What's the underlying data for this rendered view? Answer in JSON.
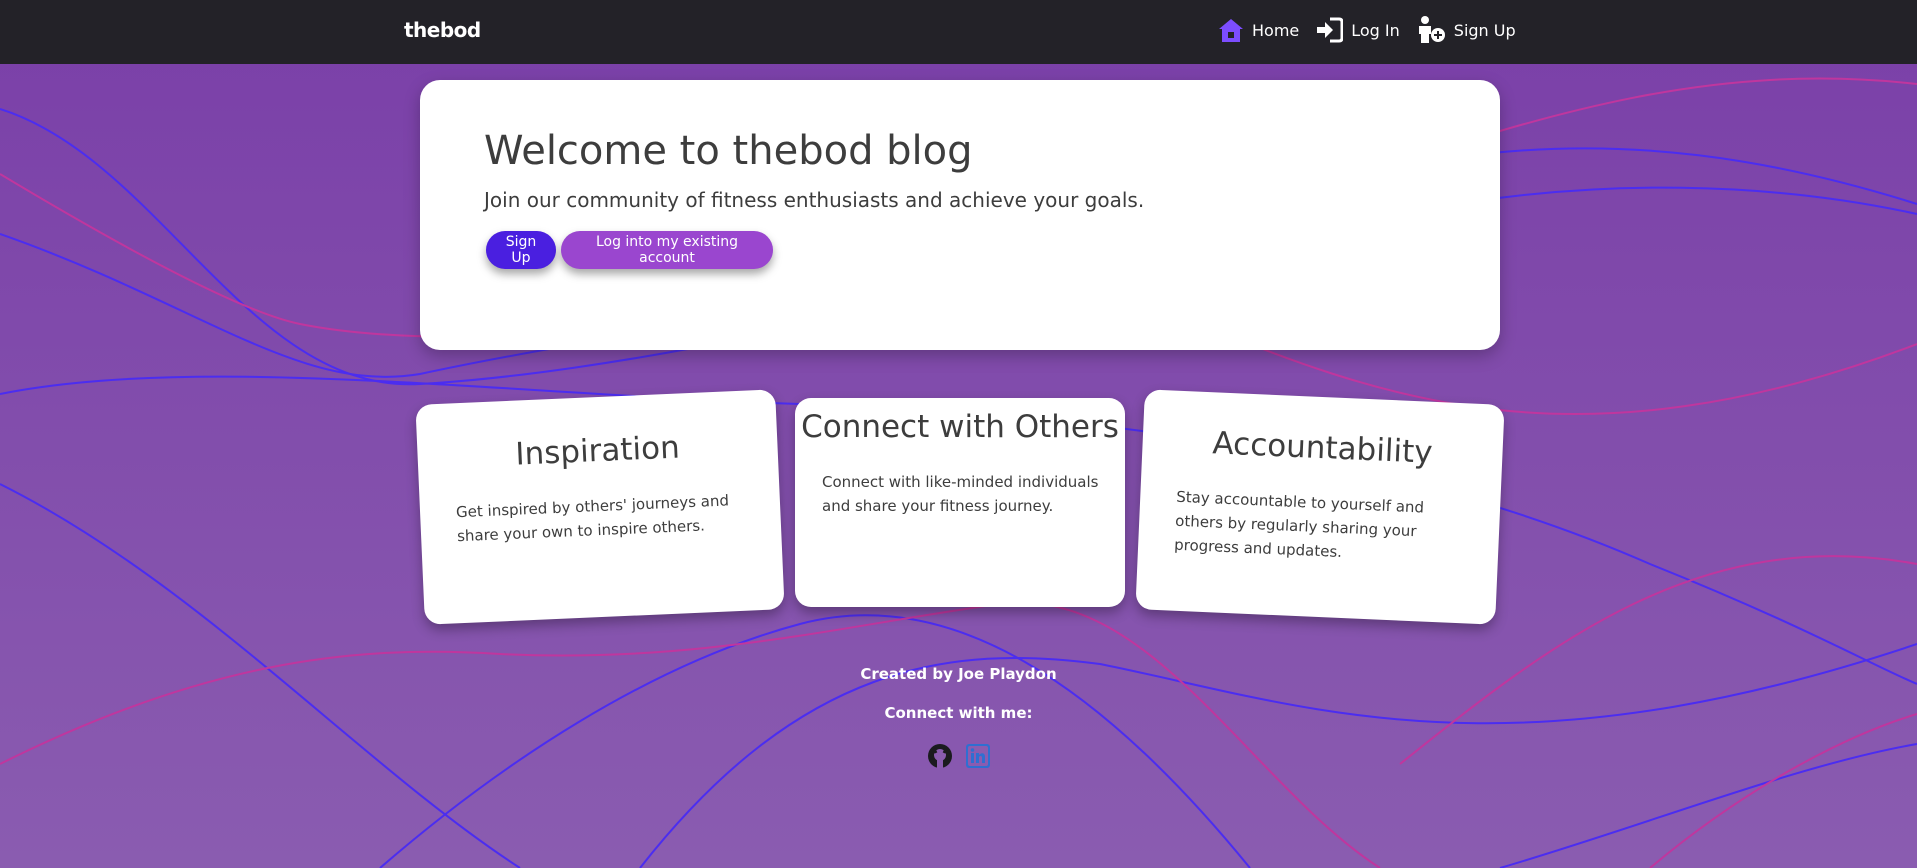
{
  "nav": {
    "brand": "thebod",
    "links": [
      {
        "label": "Home",
        "icon": "home-icon"
      },
      {
        "label": "Log In",
        "icon": "login-icon"
      },
      {
        "label": "Sign Up",
        "icon": "user-plus-icon"
      }
    ]
  },
  "hero": {
    "title": "Welcome to thebod blog",
    "subtitle": "Join our community of fitness enthusiasts and achieve your goals.",
    "signup_button": "Sign Up",
    "login_button": "Log into my existing account"
  },
  "cards": [
    {
      "title": "Inspiration",
      "text": "Get inspired by others' journeys and share your own to inspire others."
    },
    {
      "title": "Connect with Others",
      "text": "Connect with like-minded individuals and share your fitness journey."
    },
    {
      "title": "Accountability",
      "text": "Stay accountable to yourself and others by regularly sharing your progress and updates."
    }
  ],
  "footer": {
    "credit": "Created by Joe Playdon",
    "connect": "Connect with me:",
    "socials": [
      {
        "icon": "github-icon"
      },
      {
        "icon": "linkedin-icon"
      }
    ]
  },
  "colors": {
    "navbar": "#232228",
    "background_top": "#7a3fa8",
    "background_bottom": "#8a5cb0",
    "primary_button": "#4a1fe0",
    "secondary_button": "#9a46cf",
    "home_icon": "#7c4dff",
    "wave_blue": "#4b2df0",
    "wave_pink": "#c0369e",
    "linkedin": "#2f6fd1"
  }
}
